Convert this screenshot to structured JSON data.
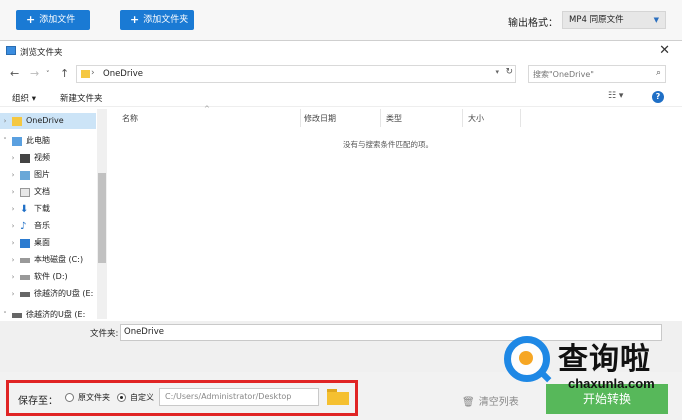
{
  "toolbar": {
    "add_file": "添加文件",
    "add_folder": "添加文件夹",
    "output_format_label": "输出格式：",
    "output_format_value": "MP4  同原文件"
  },
  "dialog": {
    "title": "浏览文件夹",
    "address_path": "OneDrive",
    "search_placeholder": "搜索\"OneDrive\"",
    "organize": "组织 ▾",
    "new_folder": "新建文件夹",
    "columns": [
      "名称",
      "修改日期",
      "类型",
      "大小"
    ],
    "empty_message": "没有与搜索条件匹配的项。",
    "tree": [
      {
        "label": "OneDrive",
        "icon": "folder-icon",
        "selected": true
      },
      {
        "label": "此电脑",
        "icon": "computer-icon",
        "expanded": true
      },
      {
        "label": "视频",
        "icon": "video-icon"
      },
      {
        "label": "图片",
        "icon": "picture-icon"
      },
      {
        "label": "文档",
        "icon": "document-icon"
      },
      {
        "label": "下载",
        "icon": "download-icon"
      },
      {
        "label": "音乐",
        "icon": "music-icon"
      },
      {
        "label": "桌面",
        "icon": "desktop-icon"
      },
      {
        "label": "本地磁盘 (C:)",
        "icon": "drive-icon"
      },
      {
        "label": "软件 (D:)",
        "icon": "drive-icon"
      },
      {
        "label": "徐越济的U盘 (E:",
        "icon": "usb-drive-icon"
      },
      {
        "label": "徐越济的U盘 (E:",
        "icon": "usb-drive-icon"
      }
    ],
    "folder_label": "文件夹:",
    "folder_value": "OneDrive"
  },
  "bottom": {
    "save_to": "保存至：",
    "option_original": "原文件夹",
    "option_custom": "自定义",
    "custom_selected": true,
    "path_placeholder": "C:/Users/Administrator/Desktop",
    "clear_list": "清空列表",
    "start": "开始转换"
  },
  "watermark": {
    "cn": "查询啦",
    "en": "chaxunla.com"
  },
  "colors": {
    "accent_blue": "#1a7ad4",
    "highlight_red": "#e02424",
    "start_green": "#57b85a"
  }
}
